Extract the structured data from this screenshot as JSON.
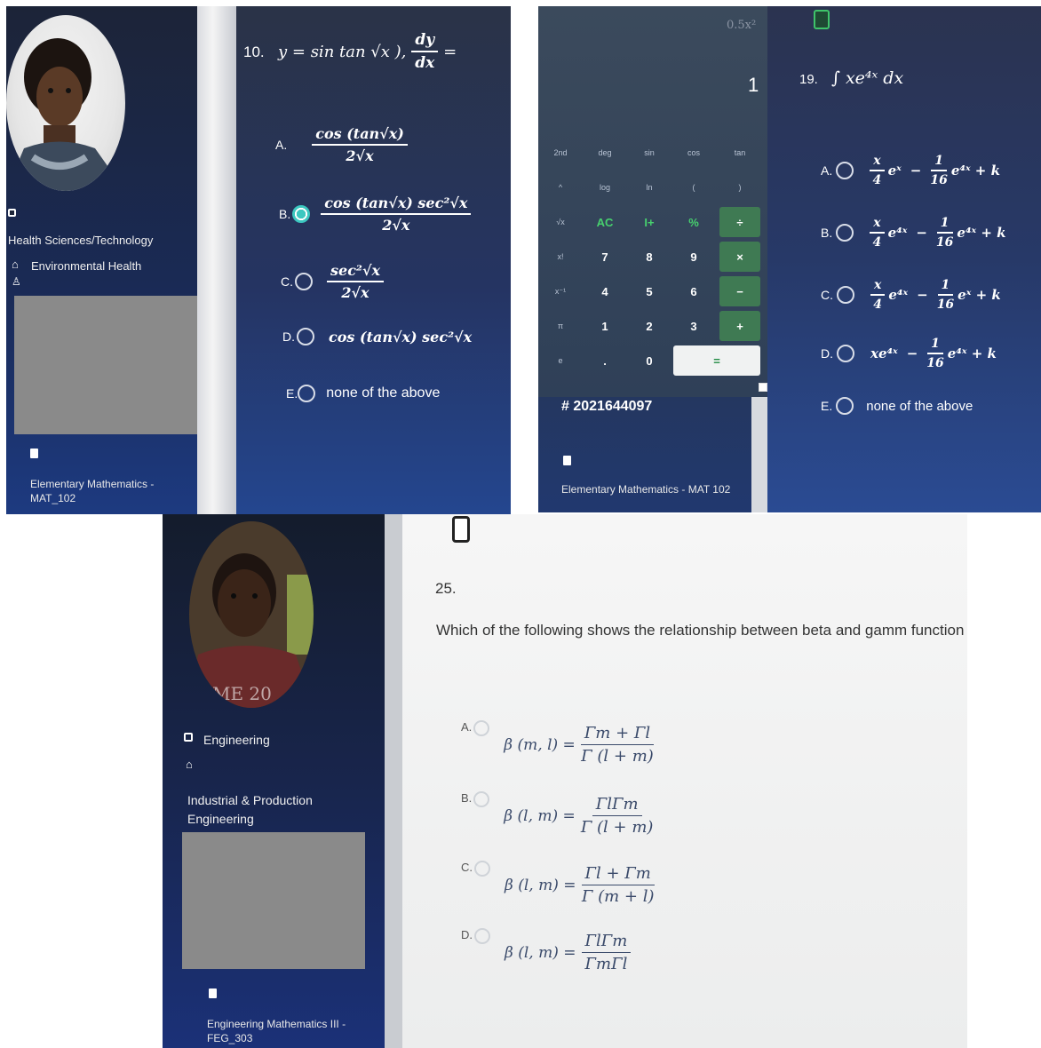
{
  "panel1": {
    "sidebar": {
      "course_label": "Elementary Mathematics - MAT_102",
      "faculty": "Health Sciences/Technology",
      "department": "Environmental Health"
    },
    "question": {
      "number": "10.",
      "stem": "y = sin tan √x ),",
      "derivative_num": "dy",
      "derivative_den": "dx",
      "equals": "=",
      "options": [
        {
          "letter": "A.",
          "num": "cos (tan√x)",
          "den": "2√x",
          "selected": false
        },
        {
          "letter": "B.",
          "num": "cos (tan√x) sec²√x",
          "den": "2√x",
          "selected": true
        },
        {
          "letter": "C.",
          "num": "sec²√x",
          "den": "2√x",
          "selected": false
        },
        {
          "letter": "D.",
          "text": "cos (tan√x) sec²√x",
          "selected": false
        },
        {
          "letter": "E.",
          "text": "none of the above",
          "selected": false
        }
      ]
    }
  },
  "panel2": {
    "calculator": {
      "memory_display": "0.5x²",
      "display_value": "1",
      "rows": [
        [
          "2nd",
          "deg",
          "sin",
          "cos",
          "tan"
        ],
        [
          "^",
          "log",
          "ln",
          "(",
          ")"
        ],
        [
          "√x",
          "AC",
          "I+",
          "%",
          "÷"
        ],
        [
          "x!",
          "7",
          "8",
          "9",
          "×"
        ],
        [
          "x⁻¹",
          "4",
          "5",
          "6",
          "−"
        ],
        [
          "π",
          "1",
          "2",
          "3",
          "+"
        ],
        [
          "e",
          ".",
          "0",
          "="
        ]
      ]
    },
    "student_id": "# 2021644097",
    "course_label": "Elementary Mathematics - MAT 102",
    "question": {
      "number": "19.",
      "stem": "∫ xe⁴ˣ dx",
      "options": [
        {
          "letter": "A.",
          "part1_num": "x",
          "part1_den": "4",
          "part1_exp": "eˣ",
          "mid": "−",
          "part2_num": "1",
          "part2_den": "16",
          "part2_exp": "e⁴ˣ + k"
        },
        {
          "letter": "B.",
          "part1_num": "x",
          "part1_den": "4",
          "part1_exp": "e⁴ˣ",
          "mid": "−",
          "part2_num": "1",
          "part2_den": "16",
          "part2_exp": "e⁴ˣ + k"
        },
        {
          "letter": "C.",
          "part1_num": "x",
          "part1_den": "4",
          "part1_exp": "e⁴ˣ",
          "mid": "−",
          "part2_num": "1",
          "part2_den": "16",
          "part2_exp": "eˣ + k"
        },
        {
          "letter": "D.",
          "lead": "xe⁴ˣ",
          "mid": "−",
          "part2_num": "1",
          "part2_den": "16",
          "part2_exp": "e⁴ˣ + k"
        },
        {
          "letter": "E.",
          "text": "none of the above"
        }
      ]
    }
  },
  "panel3": {
    "sidebar": {
      "photo_caption": "ME 20",
      "faculty": "Engineering",
      "department": "Industrial & Production Engineering",
      "course_label": "Engineering Mathematics III - FEG_303"
    },
    "question": {
      "number": "25.",
      "text": "Which of the following shows the relationship between beta and gamm function",
      "options": [
        {
          "letter": "A.",
          "lhs": "β (m, l) =",
          "num": "Γm + Γl",
          "den": "Γ (l + m)"
        },
        {
          "letter": "B.",
          "lhs": "β (l, m) =",
          "num": "ΓlΓm",
          "den": "Γ (l + m)"
        },
        {
          "letter": "C.",
          "lhs": "β (l, m) =",
          "num": "Γl + Γm",
          "den": "Γ (m + l)"
        },
        {
          "letter": "D.",
          "lhs": "β (l, m) =",
          "num": "ΓlΓm",
          "den": "ΓmΓl"
        }
      ]
    }
  }
}
